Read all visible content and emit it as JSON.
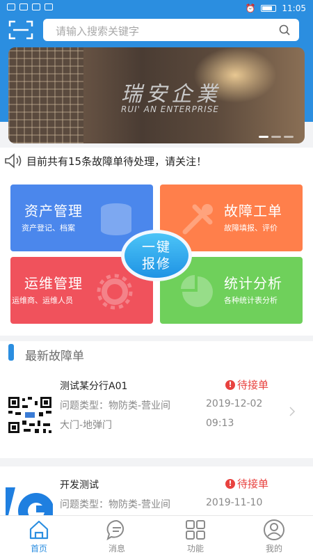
{
  "status_bar": {
    "time": "11:05"
  },
  "search": {
    "placeholder": "请输入搜索关键字"
  },
  "banner": {
    "title": "瑞安企業",
    "subtitle": "RUI' AN ENTERPRISE"
  },
  "notice": {
    "text": "目前共有15条故障单待处理，请关注！"
  },
  "tiles": [
    {
      "title": "资产管理",
      "subtitle": "资产登记、档案"
    },
    {
      "title": "故障工单",
      "subtitle": "故障填报、评价"
    },
    {
      "title": "运维管理",
      "subtitle": "运维商、运维人员"
    },
    {
      "title": "统计分析",
      "subtitle": "各种统计表分析"
    }
  ],
  "repair_button": {
    "line1": "一键",
    "line2": "报修"
  },
  "latest": {
    "title": "最新故障单",
    "orders": [
      {
        "title": "测试某分行A01",
        "status": "待接单",
        "type": "问题类型：物防类-营业间",
        "date": "2019-12-02",
        "location": "大门-地弹门",
        "time": "09:13"
      },
      {
        "title": "开发测试",
        "status": "待接单",
        "type": "问题类型：物防类-营业间",
        "date": "2019-11-10"
      }
    ]
  },
  "tabbar": {
    "items": [
      {
        "label": "首页"
      },
      {
        "label": "消息"
      },
      {
        "label": "功能"
      },
      {
        "label": "我的"
      }
    ]
  },
  "colors": {
    "primary": "#2b8ee0",
    "asset": "#4b87ec",
    "fault": "#ff7f4b",
    "ops": "#f0525c",
    "stats": "#6fd05b",
    "alert": "#e8423f"
  },
  "icons": [
    "scan-icon",
    "search-icon",
    "speaker-icon",
    "home-icon",
    "message-icon",
    "grid-icon",
    "user-icon"
  ]
}
